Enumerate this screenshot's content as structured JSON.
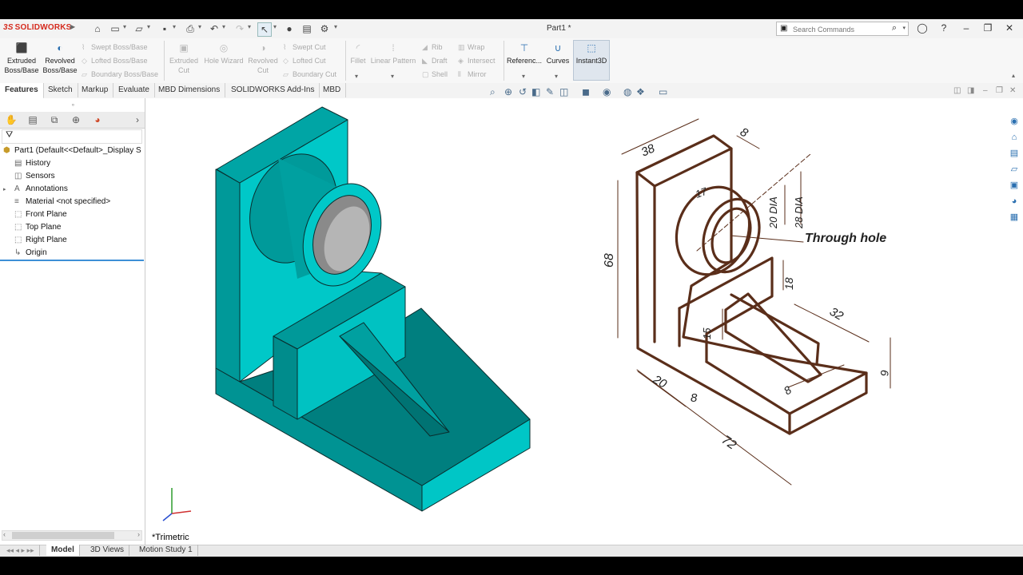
{
  "app": {
    "logo_text": "SOLIDWORKS",
    "logo_mark": "3S",
    "doc_title": "Part1 *"
  },
  "search": {
    "placeholder": "Search Commands"
  },
  "commands": {
    "extruded_boss": "Extruded Boss/Base",
    "revolved_boss": "Revolved Boss/Base",
    "swept_boss": "Swept Boss/Base",
    "lofted_boss": "Lofted Boss/Base",
    "boundary_boss": "Boundary Boss/Base",
    "extruded_cut": "Extruded Cut",
    "hole_wizard": "Hole Wizard",
    "revolved_cut": "Revolved Cut",
    "swept_cut": "Swept Cut",
    "lofted_cut": "Lofted Cut",
    "boundary_cut": "Boundary Cut",
    "fillet": "Fillet",
    "linear_pattern": "Linear Pattern",
    "rib": "Rib",
    "draft": "Draft",
    "shell": "Shell",
    "wrap": "Wrap",
    "intersect": "Intersect",
    "mirror": "Mirror",
    "reference": "Referenc...",
    "curves": "Curves",
    "instant3d": "Instant3D"
  },
  "tabs": [
    "Features",
    "Sketch",
    "Markup",
    "Evaluate",
    "MBD Dimensions",
    "SOLIDWORKS Add-Ins",
    "MBD"
  ],
  "tree": {
    "root": "Part1  (Default<<Default>_Display S",
    "items": [
      "History",
      "Sensors",
      "Annotations",
      "Material <not specified>",
      "Front Plane",
      "Top Plane",
      "Right Plane",
      "Origin"
    ]
  },
  "view": {
    "orientation": "*Trimetric"
  },
  "drawing": {
    "dims": [
      "38",
      "8",
      "17",
      "20 DIA",
      "28 DIA",
      "68",
      "18",
      "15",
      "32",
      "20",
      "8",
      "8",
      "6",
      "72"
    ],
    "note": "Through hole"
  },
  "bottom_tabs": [
    "Model",
    "3D Views",
    "Motion Study 1"
  ],
  "colors": {
    "model": "#00cccc",
    "model_dark": "#008b8b",
    "sketch_ink": "#5a2e1a",
    "accent": "#3d8fd6"
  }
}
